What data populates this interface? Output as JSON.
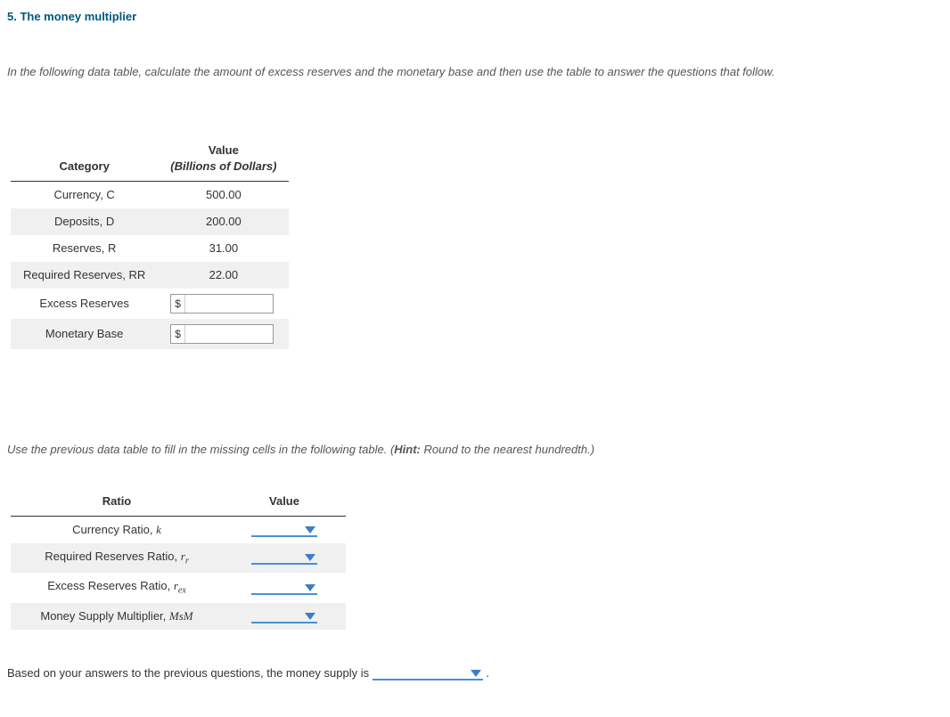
{
  "title": "5. The money multiplier",
  "instructions1": "In the following data table, calculate the amount of excess reserves and the monetary base and then use the table to answer the questions that follow.",
  "table1": {
    "head_col1": "Category",
    "head_col2_line1": "Value",
    "head_col2_line2": "(Billions of Dollars)",
    "rows": [
      {
        "label": "Currency, C",
        "value": "500.00"
      },
      {
        "label": "Deposits, D",
        "value": "200.00"
      },
      {
        "label": "Reserves, R",
        "value": "31.00"
      },
      {
        "label": "Required Reserves, RR",
        "value": "22.00"
      }
    ],
    "input_rows": [
      {
        "label": "Excess Reserves",
        "prefix": "$"
      },
      {
        "label": "Monetary Base",
        "prefix": "$"
      }
    ]
  },
  "instructions2_pre": "Use the previous data table to fill in the missing cells in the following table. (",
  "instructions2_hint_label": "Hint:",
  "instructions2_hint_text": " Round to the nearest hundredth.)",
  "table2": {
    "head_col1": "Ratio",
    "head_col2": "Value",
    "rows": [
      {
        "label_html": "Currency Ratio, <span class='mathit'>k</span>"
      },
      {
        "label_html": "Required Reserves Ratio, <span class='mathit'>r</span><span class='sub-sm'>r</span>"
      },
      {
        "label_html": "Excess Reserves Ratio, <span class='mathit'>r</span><span class='sub-sm'>ex</span>"
      },
      {
        "label_html": "Money Supply Multiplier, <span class='mathit'>MsM</span>"
      }
    ]
  },
  "final_pre": "Based on your answers to the previous questions, the money supply is ",
  "final_post": " ."
}
